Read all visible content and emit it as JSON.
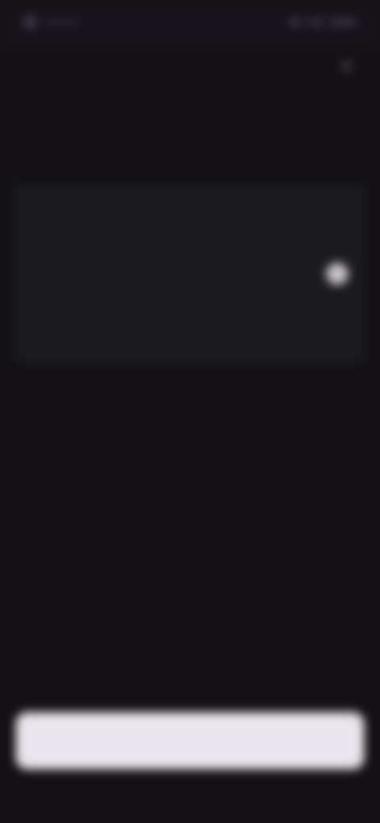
{
  "status_bar": {
    "time": "",
    "indicators": ""
  },
  "header": {
    "close_icon": "close-icon",
    "title": ""
  },
  "options": [
    {
      "label": "",
      "selected": false
    },
    {
      "label": "",
      "selected": true
    },
    {
      "label": "",
      "selected": false
    }
  ],
  "footer": {
    "continue_label": ""
  },
  "colors": {
    "background": "#141116",
    "options_panel": "#1b1a1e",
    "button": "#e9e5ec",
    "radio_selected": "#c9c4cc"
  }
}
